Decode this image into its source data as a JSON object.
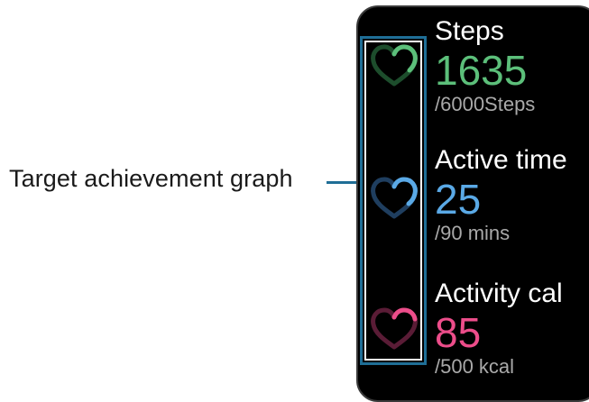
{
  "callout": {
    "label": "Target achievement graph"
  },
  "colors": {
    "steps": "#5cbf7a",
    "active_time": "#5aa9e6",
    "activity_cal": "#ec4d8a",
    "callout_line": "#1f6e96"
  },
  "metrics": [
    {
      "label": "Steps",
      "value": "1635",
      "goal": "/6000Steps",
      "icon": "steps-heart-icon",
      "progress": 0.27
    },
    {
      "label": "Active time",
      "value": "25",
      "goal": "/90 mins",
      "icon": "active-time-heart-icon",
      "progress": 0.28
    },
    {
      "label": "Activity cal",
      "value": "85",
      "goal": "/500 kcal",
      "icon": "activity-cal-heart-icon",
      "progress": 0.17
    }
  ]
}
